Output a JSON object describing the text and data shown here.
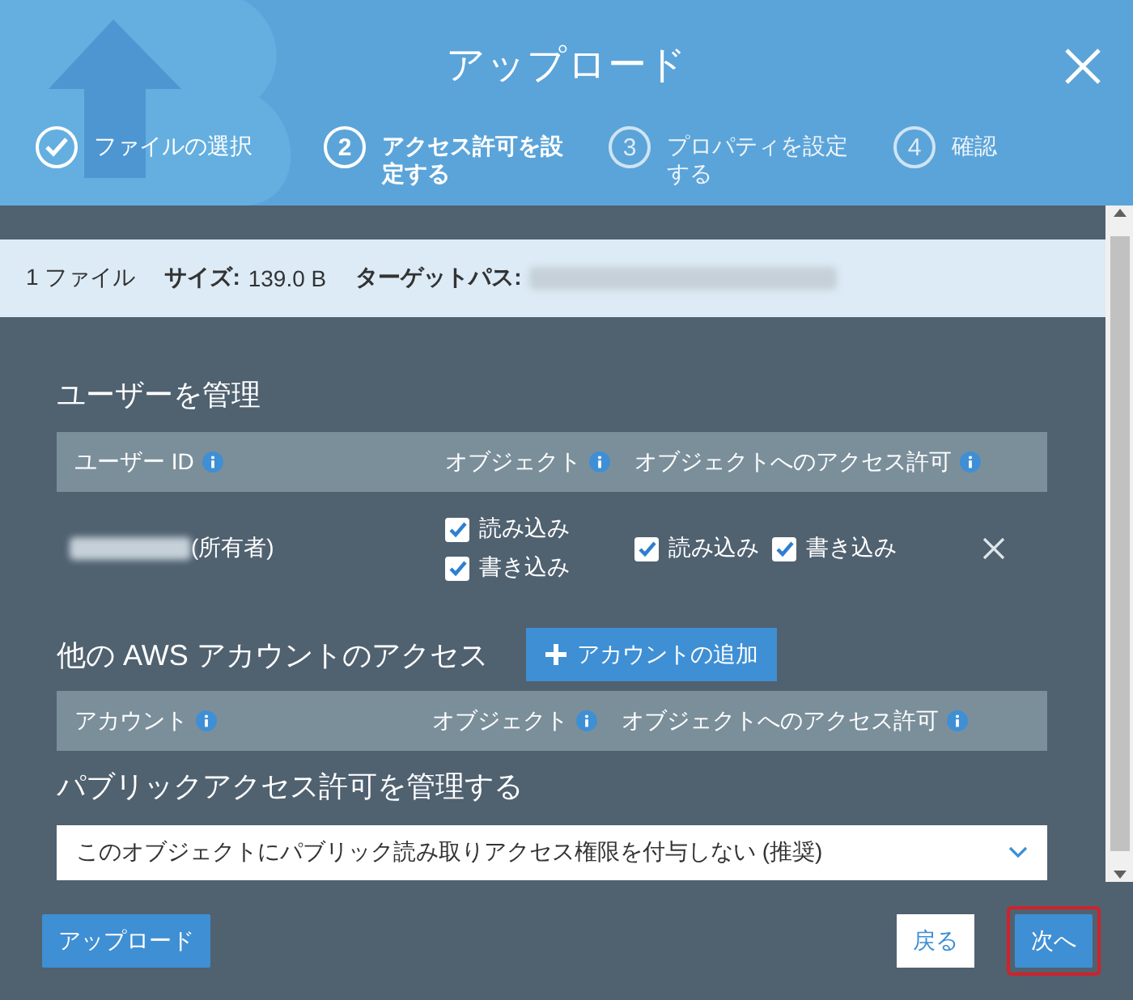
{
  "dialog": {
    "title": "アップロード"
  },
  "steps": [
    {
      "label": "ファイルの選択",
      "completed": true,
      "selected": false
    },
    {
      "number": "2",
      "label": "アクセス許可を設定する",
      "completed": false,
      "selected": true
    },
    {
      "number": "3",
      "label": "プロパティを設定する",
      "completed": false,
      "selected": false
    },
    {
      "number": "4",
      "label": "確認",
      "completed": false,
      "selected": false
    }
  ],
  "info_bar": {
    "count": "1 ファイル",
    "size_label": "サイズ:",
    "size": "139.0 B",
    "path_label": "ターゲットパス:"
  },
  "manage_users": {
    "heading": "ユーザーを管理",
    "columns": [
      "ユーザー ID",
      "オブジェクト",
      "オブジェクトへのアクセス許可"
    ],
    "rows": [
      {
        "owner": "(所有者)",
        "object": [
          {
            "label": "読み込み",
            "checked": true
          },
          {
            "label": "書き込み",
            "checked": true
          }
        ],
        "acl": [
          {
            "label": "読み込み",
            "checked": true
          },
          {
            "label": "書き込み",
            "checked": true
          }
        ]
      }
    ]
  },
  "other_accounts": {
    "heading": "他の AWS アカウントのアクセス",
    "add_button": "アカウントの追加",
    "columns": [
      "アカウント",
      "オブジェクト",
      "オブジェクトへのアクセス許可"
    ]
  },
  "public_access": {
    "heading": "パブリックアクセス許可を管理する",
    "value": "このオブジェクトにパブリック読み取りアクセス権限を付与しない (推奨)"
  },
  "footer": {
    "upload": "アップロード",
    "back": "戻る",
    "next": "次へ",
    "next_highlighted": true
  }
}
